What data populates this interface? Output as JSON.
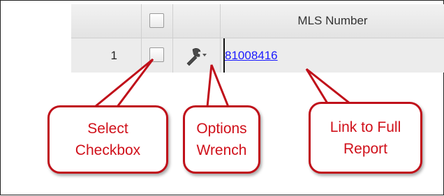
{
  "table": {
    "header": {
      "mls_label": "MLS Number"
    },
    "row": {
      "number": "1",
      "mls_number": "81008416"
    }
  },
  "callouts": {
    "select": {
      "line1": "Select",
      "line2": "Checkbox"
    },
    "options": {
      "line1": "Options",
      "line2": "Wrench"
    },
    "link": {
      "line1": "Link to Full",
      "line2": "Report"
    }
  },
  "colors": {
    "callout_border": "#c0101a",
    "callout_text": "#d0101a",
    "link": "#1a1aff"
  },
  "icons": {
    "options": "wrench-icon"
  }
}
